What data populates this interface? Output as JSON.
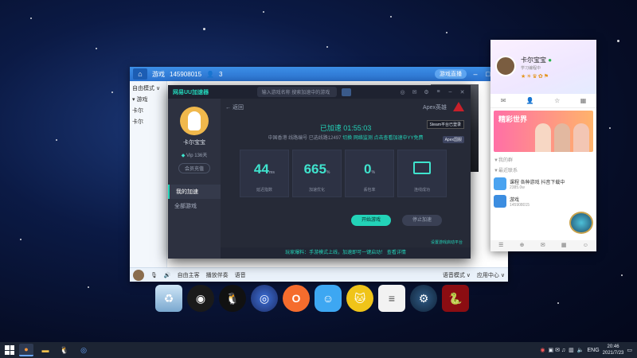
{
  "colors": {
    "accent_teal": "#23d3b8",
    "qq_blue": "#2a72d0",
    "accelerator_bg": "#262a37",
    "taskbar_bg": "#1c2433"
  },
  "chat_window": {
    "tab_title": "游戏",
    "id_text": "145908015",
    "member_count": "3",
    "top_pill": "游戏直播",
    "left_items": [
      "自由模式 ∨",
      "▾ 游戏",
      "卡尔",
      "卡尔"
    ],
    "bottom_labels": [
      "自由主客",
      "播放伴奏",
      "语音"
    ],
    "bottom_right": [
      "语音模式 ∨",
      "应用中心 ∨"
    ]
  },
  "accelerator": {
    "app_name": "网易UU加速器",
    "search_placeholder": "输入游戏名称",
    "search_placeholder2": "搜索加速中的游戏",
    "user_name": "卡尔宝宝",
    "vip_text": "Vip 136天",
    "vip_button": "会员充值",
    "nav": [
      "我的加速",
      "全部游戏"
    ],
    "back_label": "← 返回",
    "game_name": "Apex英雄",
    "tag_steam": "Steam平台已登录",
    "tag_apex": "Apex国服",
    "timer": "已加速 01:55:03",
    "sub_text": "中国香港 线路编号 已选线路12497",
    "sub_links": [
      "切换",
      "网络监测",
      "点击查看加速中YY免费"
    ],
    "stats": [
      {
        "value": "44",
        "unit": "ms",
        "label": "延迟指数"
      },
      {
        "value": "665",
        "unit": "%",
        "label": "加速优化"
      },
      {
        "value": "0",
        "unit": "%",
        "label": "丢包率"
      },
      {
        "value": "",
        "unit": "",
        "label": "连线成功"
      }
    ],
    "start_button": "开始游戏",
    "stop_button": "停止加速",
    "settings_link": "设置游戏启动平台",
    "footer": "玩家爆料：手游模式上线，加速即可一键启动！ 查看详情"
  },
  "contact_panel": {
    "name": "卡尔宝宝",
    "signature": "学习编程中",
    "banner_title": "精彩世界",
    "section_group": "▼我的群",
    "section_recent": "▼最近联系",
    "items": [
      {
        "title": "课程 各种游戏 抖音下载中",
        "sub": "2385.0w"
      },
      {
        "title": "游戏",
        "sub": "145908015"
      }
    ],
    "bottom_icons": [
      "☰",
      "⊕",
      "✉",
      "▦",
      "☺"
    ]
  },
  "dock_icons": [
    "recycle-bin",
    "obs-studio",
    "qq-penguin",
    "uu-accelerator",
    "origin",
    "bilibili-chat",
    "yy-cat",
    "document",
    "steam",
    "razer"
  ],
  "taskbar": {
    "lang": "ENG",
    "time": "20:46",
    "date": "2021/7/23"
  }
}
